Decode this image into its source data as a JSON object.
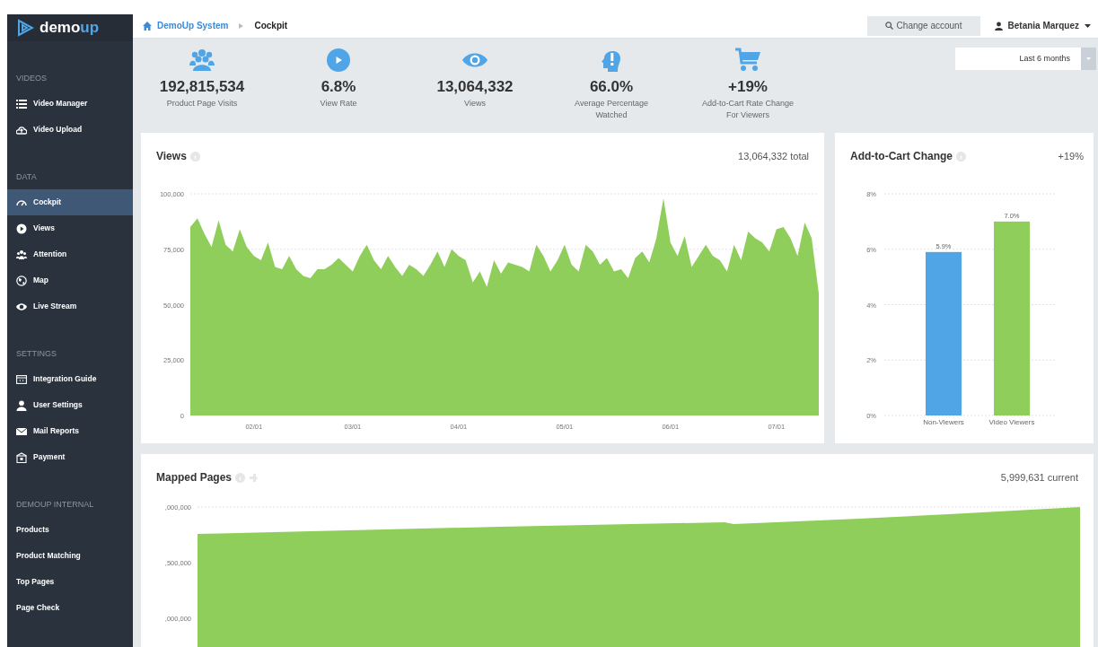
{
  "sidebar": {
    "logo": {
      "text": "demo",
      "accent": "up"
    },
    "sections": [
      {
        "title": "VIDEOS",
        "items": [
          {
            "label": "Video Manager",
            "selected": false
          },
          {
            "label": "Video Upload",
            "selected": false
          }
        ]
      },
      {
        "title": "DATA",
        "items": [
          {
            "label": "Cockpit",
            "selected": true
          },
          {
            "label": "Views",
            "selected": false
          },
          {
            "label": "Attention",
            "selected": false
          },
          {
            "label": "Map",
            "selected": false
          },
          {
            "label": "Live Stream",
            "selected": false
          }
        ]
      },
      {
        "title": "SETTINGS",
        "items": [
          {
            "label": "Integration Guide",
            "selected": false
          },
          {
            "label": "User Settings",
            "selected": false
          },
          {
            "label": "Mail Reports",
            "selected": false
          },
          {
            "label": "Payment",
            "selected": false
          }
        ]
      },
      {
        "title": "DEMOUP INTERNAL",
        "items": [
          {
            "label": "Products",
            "selected": false
          },
          {
            "label": "Product Matching",
            "selected": false
          },
          {
            "label": "Top Pages",
            "selected": false
          },
          {
            "label": "Page Check",
            "selected": false
          }
        ]
      }
    ]
  },
  "header": {
    "breadcrumb": [
      "DemoUp System",
      "Cockpit"
    ],
    "change_account": "Change account",
    "user": "Betania Marquez"
  },
  "stats": [
    {
      "value": "192,815,534",
      "label": "Product Page Visits"
    },
    {
      "value": "6.8%",
      "label": "View Rate"
    },
    {
      "value": "13,064,332",
      "label": "Views"
    },
    {
      "value": "66.0%",
      "label": "Average Percentage Watched"
    },
    {
      "value": "+19%",
      "label": "Add-to-Cart Rate Change For Viewers"
    }
  ],
  "period": "Last 6 months",
  "views_card": {
    "title": "Views",
    "total": "13,064,332 total",
    "chart_data": {
      "type": "area",
      "grid": true,
      "categories": [
        null,
        null,
        null,
        null,
        null,
        null,
        null,
        null,
        null,
        "02/01",
        null,
        null,
        null,
        null,
        null,
        null,
        null,
        null,
        null,
        null,
        null,
        null,
        null,
        "03/01",
        null,
        null,
        null,
        null,
        null,
        null,
        null,
        null,
        null,
        null,
        null,
        null,
        null,
        null,
        "04/01",
        null,
        null,
        null,
        null,
        null,
        null,
        null,
        null,
        null,
        null,
        null,
        null,
        null,
        null,
        "05/01",
        null,
        null,
        null,
        null,
        null,
        null,
        null,
        null,
        null,
        null,
        null,
        null,
        null,
        null,
        "06/01",
        null,
        null,
        null,
        null,
        null,
        null,
        null,
        null,
        null,
        null,
        null,
        null,
        null,
        null,
        "07/01",
        null,
        null,
        null,
        null,
        null,
        null
      ],
      "series": [
        {
          "color": "#8fce5a",
          "values": [
            85000,
            89000,
            82000,
            76000,
            88000,
            77000,
            74000,
            84000,
            76000,
            72000,
            70000,
            78000,
            67000,
            66000,
            72000,
            66000,
            63000,
            62000,
            66000,
            66000,
            68000,
            71000,
            68000,
            65000,
            72000,
            77000,
            70000,
            66000,
            72000,
            67000,
            63000,
            68000,
            66000,
            63000,
            68000,
            74000,
            67000,
            75000,
            72000,
            70000,
            60000,
            65000,
            58000,
            70000,
            64000,
            69000,
            68000,
            67000,
            65000,
            77000,
            72000,
            65000,
            70000,
            77000,
            68000,
            65000,
            77000,
            74000,
            68000,
            71000,
            65000,
            66000,
            62000,
            71000,
            74000,
            69000,
            80000,
            98000,
            78000,
            72000,
            81000,
            67000,
            72000,
            77000,
            72000,
            70000,
            65000,
            77000,
            70000,
            83000,
            80000,
            78000,
            74000,
            84000,
            85000,
            80000,
            72000,
            87000,
            80000,
            55000
          ]
        }
      ],
      "ylim": [
        0,
        100000
      ],
      "yticks": [
        {
          "value": 0,
          "label": "0"
        },
        {
          "value": 25000,
          "label": "25,000"
        },
        {
          "value": 50000,
          "label": "50,000"
        },
        {
          "value": 75000,
          "label": "75,000"
        },
        {
          "value": 100000,
          "label": "100,000"
        }
      ]
    }
  },
  "cart_card": {
    "title": "Add-to-Cart Change",
    "change": "+19%",
    "chart_data": {
      "type": "bar",
      "grid": true,
      "categories": [
        "Non-Viewers",
        "Video Viewers"
      ],
      "series": [
        {
          "color": "#4fa5e6",
          "values": [
            5.9,
            null
          ]
        },
        {
          "color": "#8fce5a",
          "values": [
            null,
            7.0
          ]
        }
      ],
      "ylim": [
        0,
        8
      ],
      "yticks": [
        {
          "value": 0,
          "label": "0%"
        },
        {
          "value": 2,
          "label": "2%"
        },
        {
          "value": 4,
          "label": "4%"
        },
        {
          "value": 6,
          "label": "6%"
        },
        {
          "value": 8,
          "label": "8%"
        }
      ],
      "value_labels": [
        "5.9%",
        "7.0%"
      ]
    }
  },
  "mapped_card": {
    "title": "Mapped Pages",
    "current": "5,999,631 current",
    "axis_labels": [
      ",000,000",
      ",500,000",
      ",000,000"
    ]
  }
}
